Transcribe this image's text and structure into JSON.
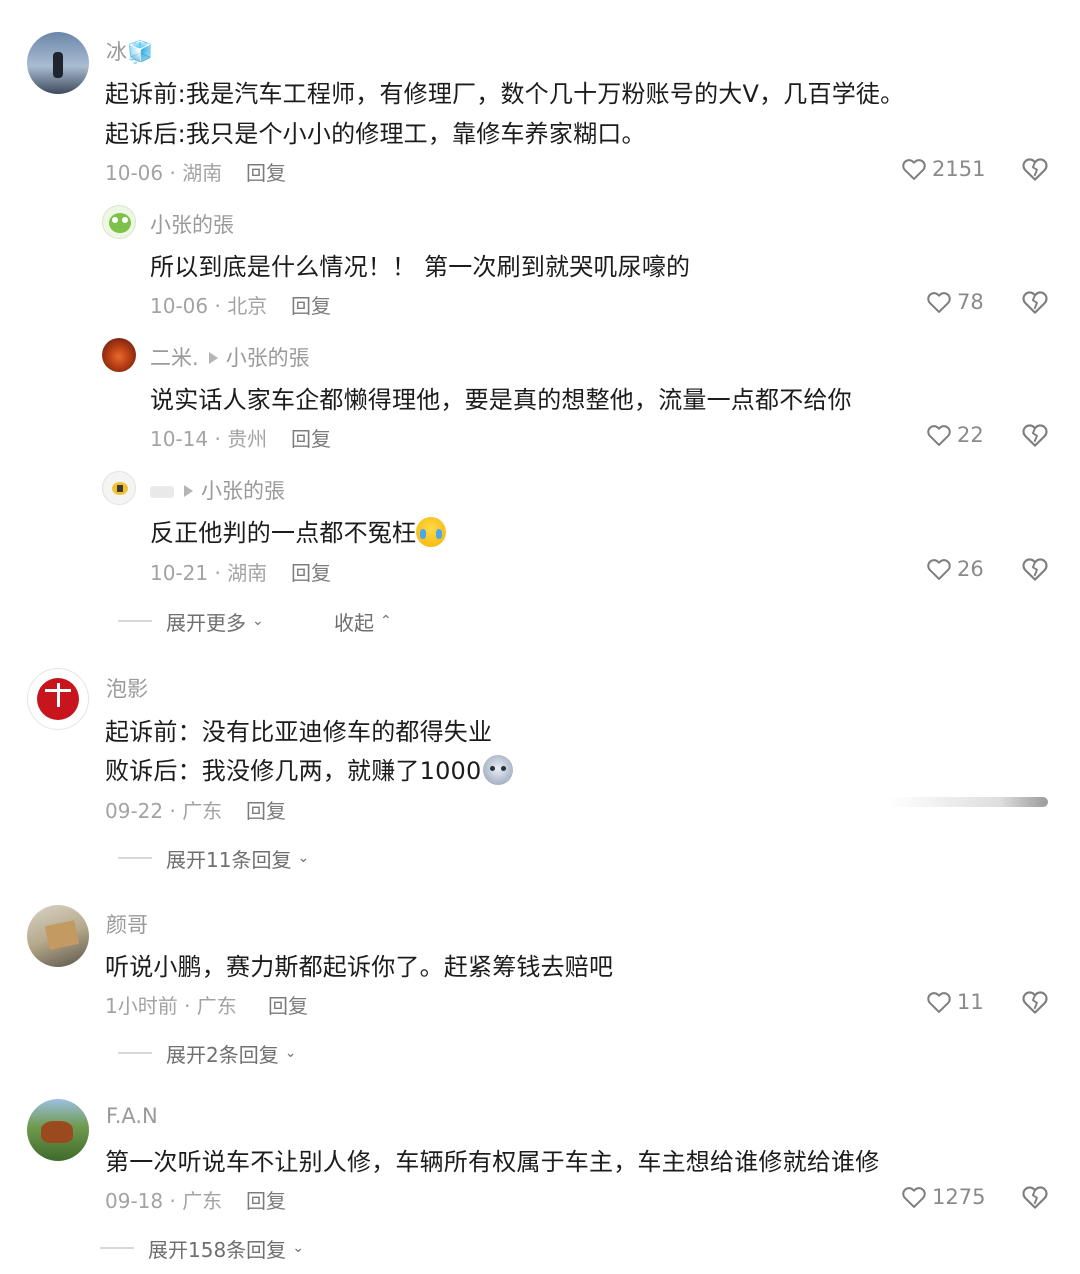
{
  "comments": [
    {
      "user": "冰🧊",
      "lines": [
        "起诉前:我是汽车工程师，有修理厂，数个几十万粉账号的大V，几百学徒。",
        "起诉后:我只是个小小的修理工，靠修车养家糊口。"
      ],
      "date": "10-06 · 湖南",
      "reply": "回复",
      "likes": "2151",
      "replies": [
        {
          "user": "小张的張",
          "text": "所以到底是什么情况！！ 第一次刷到就哭叽尿嚎的",
          "date": "10-06 · 北京",
          "reply": "回复",
          "likes": "78"
        },
        {
          "user": "二米.",
          "to": "小张的張",
          "text": "说实话人家车企都懒得理他，要是真的想整他，流量一点都不给你",
          "date": "10-14 · 贵州",
          "reply": "回复",
          "likes": "22"
        },
        {
          "user": "",
          "to": "小张的張",
          "text": "反正他判的一点都不冤枉",
          "date": "10-21 · 湖南",
          "reply": "回复",
          "likes": "26"
        }
      ],
      "expand_more": "展开更多",
      "collapse": "收起"
    },
    {
      "user": "泡影",
      "lines": [
        "起诉前：没有比亚迪修车的都得失业",
        "败诉后：我没修几两，就赚了1000"
      ],
      "date": "09-22 · 广东",
      "reply": "回复",
      "expand": "展开11条回复"
    },
    {
      "user": "颜哥",
      "lines": [
        "听说小鹏，赛力斯都起诉你了。赶紧筹钱去赔吧"
      ],
      "date": "1小时前 · 广东",
      "reply": "回复",
      "likes": "11",
      "expand": "展开2条回复"
    },
    {
      "user": "F.A.N",
      "lines": [
        "第一次听说车不让别人修，车辆所有权属于车主，车主想给谁修就给谁修"
      ],
      "date": "09-18 · 广东",
      "reply": "回复",
      "likes": "1275",
      "expand": "展开158条回复"
    }
  ],
  "icons": {
    "like": "heart-outline-icon",
    "dislike": "broken-heart-icon",
    "chevron_down": "chevron-down-icon",
    "chevron_up": "chevron-up-icon"
  }
}
